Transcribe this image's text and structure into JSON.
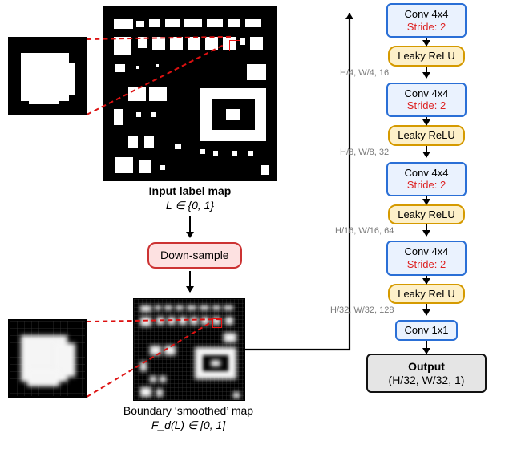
{
  "left": {
    "input_caption_bold": "Input label map",
    "input_caption_math": "L ∈ {0, 1}",
    "downsample_label": "Down-sample",
    "smoothed_caption_main": "Boundary ‘smoothed’ map",
    "smoothed_caption_math": "F_d(L) ∈ [0, 1]"
  },
  "net": {
    "blocks": [
      {
        "conv": "Conv 4x4",
        "stride": "Stride: 2",
        "act": "Leaky ReLU",
        "dim": "H/4, W/4, 16"
      },
      {
        "conv": "Conv 4x4",
        "stride": "Stride: 2",
        "act": "Leaky ReLU",
        "dim": "H/8, W/8, 32"
      },
      {
        "conv": "Conv 4x4",
        "stride": "Stride: 2",
        "act": "Leaky ReLU",
        "dim": "H/16, W/16, 64"
      },
      {
        "conv": "Conv 4x4",
        "stride": "Stride: 2",
        "act": "Leaky ReLU",
        "dim": "H/32, W/32, 128"
      }
    ],
    "conv1x1": "Conv 1x1",
    "output_title": "Output",
    "output_dim": "(H/32, W/32, 1)"
  },
  "chart_data": {
    "type": "diagram",
    "pipeline": [
      "Input label map L ∈ {0,1}",
      "Down-sample → Boundary smoothed map F_d(L) ∈ [0,1]",
      "Conv 4x4 stride 2 → Leaky ReLU → [H/4, W/4, 16]",
      "Conv 4x4 stride 2 → Leaky ReLU → [H/8, W/8, 32]",
      "Conv 4x4 stride 2 → Leaky ReLU → [H/16, W/16, 64]",
      "Conv 4x4 stride 2 → Leaky ReLU → [H/32, W/32, 128]",
      "Conv 1x1 → Output [H/32, W/32, 1]"
    ]
  }
}
